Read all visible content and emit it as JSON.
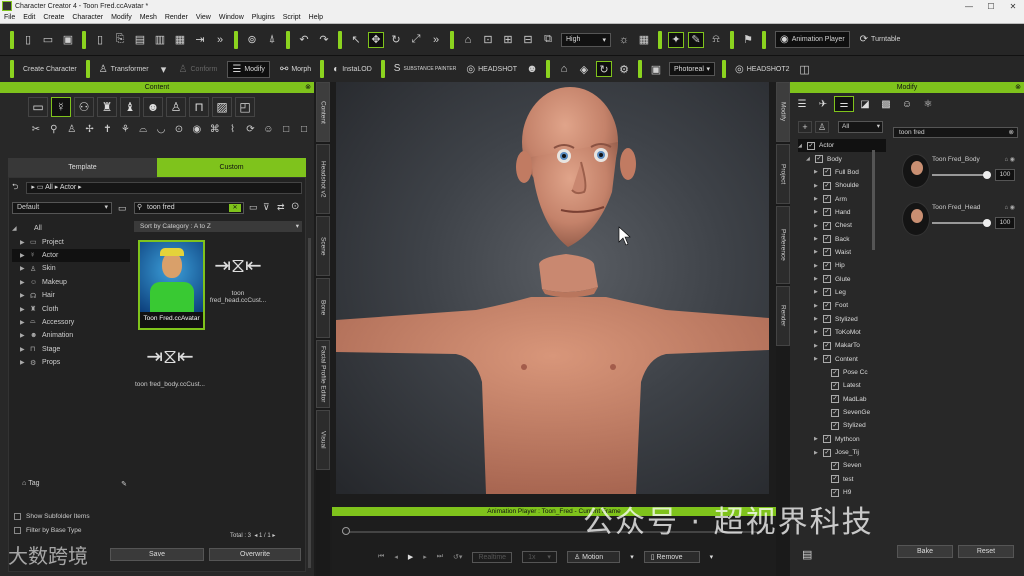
{
  "window": {
    "title": "Character Creator 4 - Toon Fred.ccAvatar *",
    "controls": [
      "—",
      "☐",
      "✕"
    ]
  },
  "menu": [
    "File",
    "Edit",
    "Create",
    "Character",
    "Modify",
    "Mesh",
    "Render",
    "View",
    "Window",
    "Plugins",
    "Script",
    "Help"
  ],
  "toolbar1": {
    "quality": "High",
    "animation_player": "Animation Player",
    "turntable": "Turntable"
  },
  "toolbar2": {
    "create_character": "Create Character",
    "transformer": "Transformer",
    "conform": "Conform",
    "modify": "Modify",
    "morph": "Morph",
    "instalod": "InstaLOD",
    "substance": "SUBSTANCE PAINTER",
    "headshot": "HEADSHOT",
    "render_mode": "Photoreal",
    "headshot2": "HEADSHOT2"
  },
  "content_panel": {
    "title": "Content",
    "tabs": {
      "template": "Template",
      "custom": "Custom"
    },
    "breadcrumb": [
      "All",
      "Actor"
    ],
    "filter": "Default",
    "search": "toon fred",
    "sort": "Sort by Category : A to Z",
    "tree": [
      "All",
      "Project",
      "Actor",
      "Skin",
      "Makeup",
      "Hair",
      "Cloth",
      "Accessory",
      "Animation",
      "Stage",
      "Props"
    ],
    "tag": "Tag",
    "items": [
      {
        "label": "Toon Fred.ccAvatar"
      },
      {
        "label": "toon fred_head.ccCust..."
      },
      {
        "label": "toon fred_body.ccCust..."
      }
    ],
    "show_subfolder": "Show Subfolder Items",
    "filter_base": "Filter by Base Type",
    "total": "Total : 3",
    "page": "1",
    "page_total": "1",
    "save": "Save",
    "overwrite": "Overwrite"
  },
  "left_vtabs": [
    "Content",
    "Headshot v2",
    "Scene",
    "Bone",
    "Facial Profile Editor",
    "Visual"
  ],
  "right_vtabs": [
    "Modify",
    "Project",
    "Preference",
    "Render"
  ],
  "animation_player": {
    "title": "Animation Player : Toon_Fred - Current Frame",
    "speed": "1x",
    "motion": "Motion",
    "remove": "Remove",
    "realtime": "Realtime"
  },
  "modify_panel": {
    "title": "Modify",
    "filter": "All",
    "search": "toon fred",
    "tree": [
      {
        "label": "Actor",
        "level": 0
      },
      {
        "label": "Body",
        "level": 1
      },
      {
        "label": "Full Bod",
        "level": 2
      },
      {
        "label": "Shoulde",
        "level": 2
      },
      {
        "label": "Arm",
        "level": 2
      },
      {
        "label": "Hand",
        "level": 2
      },
      {
        "label": "Chest",
        "level": 2
      },
      {
        "label": "Back",
        "level": 2
      },
      {
        "label": "Waist",
        "level": 2
      },
      {
        "label": "Hip",
        "level": 2
      },
      {
        "label": "Glute",
        "level": 2
      },
      {
        "label": "Leg",
        "level": 2
      },
      {
        "label": "Foot",
        "level": 2
      },
      {
        "label": "Stylized",
        "level": 2
      },
      {
        "label": "ToKoMot",
        "level": 2
      },
      {
        "label": "MakarTo",
        "level": 2
      },
      {
        "label": "Content",
        "level": 2
      },
      {
        "label": "Pose Cc",
        "level": 3
      },
      {
        "label": "Latest",
        "level": 3
      },
      {
        "label": "MadLab",
        "level": 3
      },
      {
        "label": "SevenGe",
        "level": 3
      },
      {
        "label": "Stylized",
        "level": 3
      },
      {
        "label": "Mythcon",
        "level": 2
      },
      {
        "label": "Jose_Tij",
        "level": 2
      },
      {
        "label": "Seven",
        "level": 3
      },
      {
        "label": "test",
        "level": 3
      },
      {
        "label": "H9",
        "level": 3
      }
    ],
    "morphs": [
      {
        "name": "Toon Fred_Body",
        "value": "100",
        "level": 1.0
      },
      {
        "name": "Toon Fred_Head",
        "value": "100",
        "level": 1.0
      }
    ],
    "bake": "Bake",
    "reset": "Reset"
  },
  "watermark": "公众号 · 超视界科技",
  "watermark2": "大数跨境",
  "colors": {
    "accent": "#7fc31c",
    "panel": "#282828",
    "viewport": "#3e4248"
  }
}
